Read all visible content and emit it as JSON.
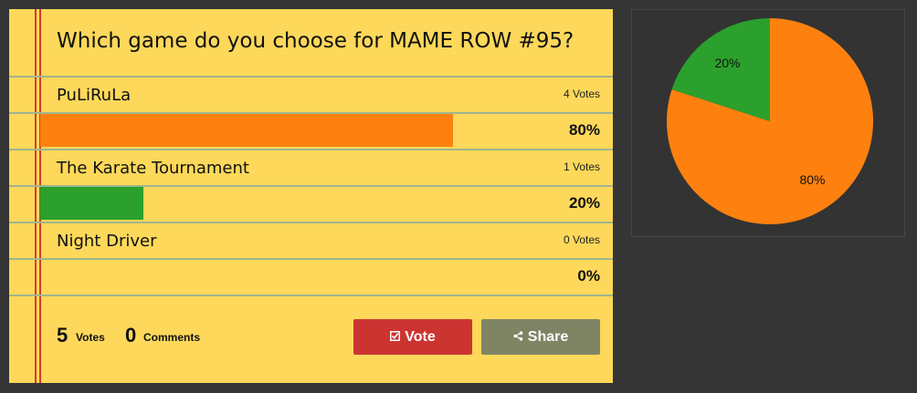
{
  "poll": {
    "title": "Which game do you choose for MAME ROW #95?",
    "options": [
      {
        "name": "PuLiRuLa",
        "votes_label": "4 Votes",
        "percent_label": "80%",
        "share": 0.8,
        "color": "#fe8110"
      },
      {
        "name": "The Karate Tournament",
        "votes_label": "1 Votes",
        "percent_label": "20%",
        "share": 0.2,
        "color": "#2ca02c"
      },
      {
        "name": "Night Driver",
        "votes_label": "0 Votes",
        "percent_label": "0%",
        "share": 0.0,
        "color": "#fe8110"
      }
    ],
    "footer": {
      "votes_count": "5",
      "votes_label": "Votes",
      "comments_count": "0",
      "comments_label": "Comments"
    },
    "buttons": {
      "vote_label": "Vote",
      "vote_icon": "check-square-icon",
      "share_label": "Share",
      "share_icon": "share-icon"
    }
  },
  "chart_data": {
    "type": "pie",
    "categories": [
      "PuLiRuLa",
      "The Karate Tournament"
    ],
    "values": [
      80,
      20
    ],
    "labels": [
      "80%",
      "20%"
    ],
    "colors": [
      "#fe8110",
      "#2ca02c"
    ]
  }
}
